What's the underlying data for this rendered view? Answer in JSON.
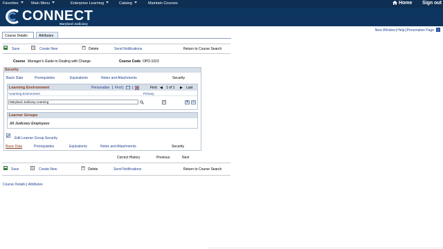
{
  "topnav": {
    "items": [
      "Favorites",
      "Main Menu",
      "Enterprise Learning",
      "Catalog",
      "Maintain Courses"
    ],
    "home": "Home",
    "signout": "Sign out"
  },
  "banner": {
    "title": "CONNECT",
    "subtitle": "Maryland Judiciary"
  },
  "header_links": {
    "new_window": "New Window",
    "help": "Help",
    "personalize_page": "Personalize Page"
  },
  "tabs": [
    "Course Details",
    "Attributes"
  ],
  "toolbar": {
    "save": "Save",
    "create_new": "Create New",
    "delete": "Delete",
    "send_notifications": "Send Notifications",
    "return": "Return to Course Search"
  },
  "course": {
    "course_label": "Course",
    "course_value": "Manager's Guide to Dealing with Change",
    "code_label": "Course Code",
    "code_value": "OPD-1023"
  },
  "security_box": {
    "title": "Security",
    "nav": [
      "Basic Data",
      "Prerequisites",
      "Equivalents",
      "Notes and Attachments",
      "Security"
    ]
  },
  "grid": {
    "title": "Learning Environment",
    "personalize": "Personalize",
    "find": "Find",
    "first": "First",
    "range": "1 of 1",
    "last": "Last",
    "col_le": "*Learning Environment",
    "col_primary": "Primary",
    "le_value": "Maryland Judiciary Learning",
    "primary_checked": true
  },
  "learner_groups": {
    "title": "Learner Groups",
    "value": "All Judiciary Employees"
  },
  "edit_security": "Edit Learner Group Security",
  "history_nav": {
    "correct_history": "Correct History",
    "previous": "Previous",
    "next": "Next"
  },
  "footer_links": {
    "course_details": "Course Details",
    "attributes": "Attributes"
  }
}
